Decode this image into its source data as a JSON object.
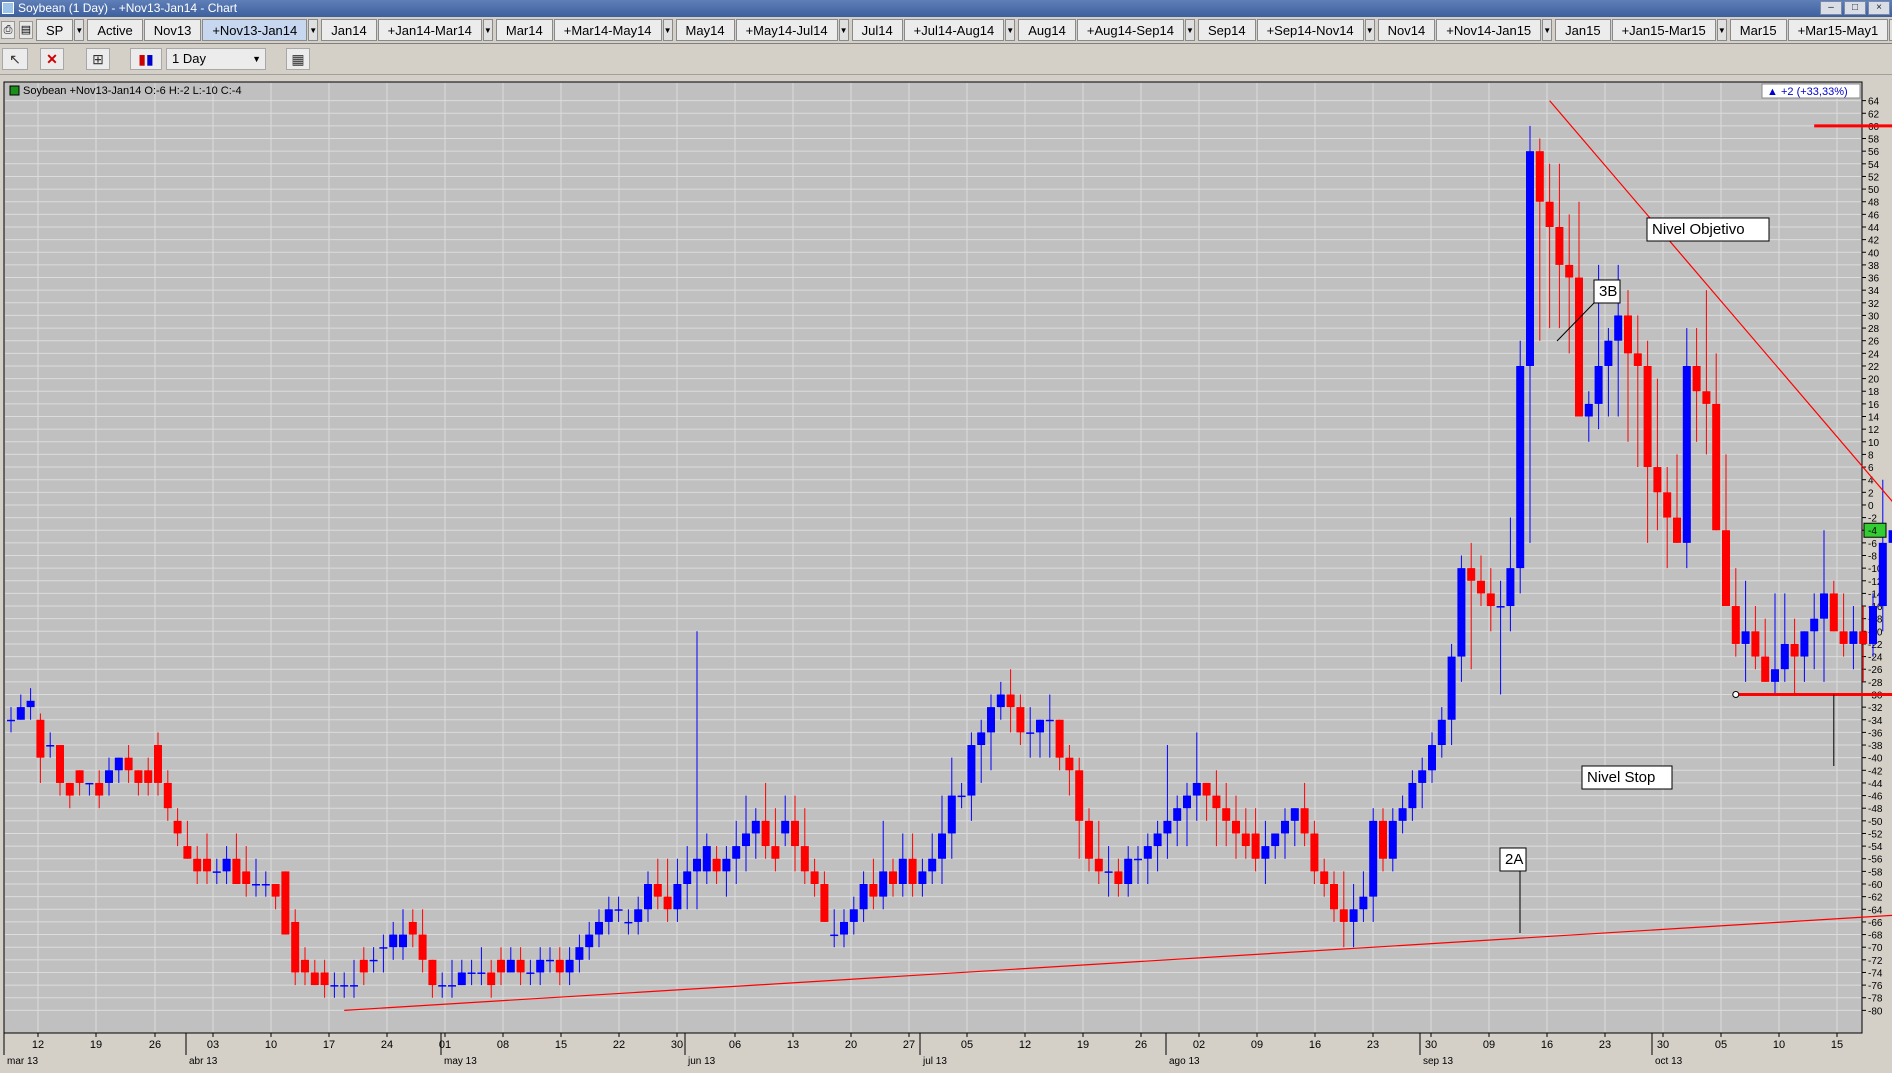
{
  "window": {
    "title": "Soybean (1 Day) - +Nov13-Jan14 - Chart",
    "buttons": [
      "–",
      "□",
      "×"
    ]
  },
  "tabs": [
    "SP",
    "Active",
    "Nov13",
    "+Nov13-Jan14",
    "Jan14",
    "+Jan14-Mar14",
    "Mar14",
    "+Mar14-May14",
    "May14",
    "+May14-Jul14",
    "Jul14",
    "+Jul14-Aug14",
    "Aug14",
    "+Aug14-Sep14",
    "Sep14",
    "+Sep14-Nov14",
    "Nov14",
    "+Nov14-Jan15",
    "Jan15",
    "+Jan15-Mar15",
    "Mar15",
    "+Mar15-May1"
  ],
  "selected_tab": "+Nov13-Jan14",
  "tabs_with_dropdown": [
    "SP",
    "+Nov13-Jan14",
    "+Jan14-Mar14",
    "+Mar14-May14",
    "+May14-Jul14",
    "+Jul14-Aug14",
    "+Aug14-Sep14",
    "+Sep14-Nov14",
    "+Nov14-Jan15",
    "+Jan15-Mar15",
    "+Mar15-May1"
  ],
  "toolbar": {
    "interval": "1 Day"
  },
  "chart": {
    "info": "Soybean +Nov13-Jan14 O:-6 H:-2 L:-10 C:-4",
    "change": "+2 (+33,33%)",
    "last_price": "-4",
    "annotations": {
      "objetivo": "Nivel Objetivo",
      "stop": "Nivel Stop",
      "label_3b": "3B",
      "label_2a": "2A"
    },
    "colors": {
      "up": "#0000ff",
      "down": "#ff0000",
      "background": "#c0c0c0",
      "grid": "#dcdcdc",
      "trend": "#ff0000"
    }
  },
  "chart_data": {
    "type": "candlestick",
    "ylim": [
      -82,
      66
    ],
    "y_ticks": [
      64,
      62,
      60,
      58,
      56,
      54,
      52,
      50,
      48,
      46,
      44,
      42,
      40,
      38,
      36,
      34,
      32,
      30,
      28,
      26,
      24,
      22,
      20,
      18,
      16,
      14,
      12,
      10,
      8,
      6,
      4,
      2,
      0,
      -2,
      -4,
      -6,
      -8,
      -10,
      -12,
      -14,
      -16,
      -18,
      -20,
      -22,
      -24,
      -26,
      -28,
      -30,
      -32,
      -34,
      -36,
      -38,
      -40,
      -42,
      -44,
      -46,
      -48,
      -50,
      -52,
      -54,
      -56,
      -58,
      -60,
      -62,
      -64,
      -66,
      -68,
      -70,
      -72,
      -74,
      -76,
      -78,
      -80
    ],
    "x_day_ticks": [
      "12",
      "19",
      "26",
      "03",
      "10",
      "17",
      "24",
      "01",
      "08",
      "15",
      "22",
      "30",
      "06",
      "13",
      "20",
      "27",
      "05",
      "12",
      "19",
      "26",
      "02",
      "09",
      "16",
      "23",
      "30",
      "09",
      "16",
      "23",
      "30",
      "05",
      "10",
      "15"
    ],
    "x_month_ticks": [
      "mar 13",
      "abr 13",
      "may 13",
      "jun 13",
      "jul 13",
      "ago 13",
      "sep 13",
      "oct 13"
    ],
    "candles": [
      [
        -34,
        -32,
        -36,
        -34
      ],
      [
        -34,
        -30,
        -34,
        -32
      ],
      [
        -32,
        -29,
        -34,
        -31
      ],
      [
        -34,
        -33,
        -44,
        -40
      ],
      [
        -38,
        -36,
        -40,
        -38
      ],
      [
        -38,
        -38,
        -46,
        -44
      ],
      [
        -44,
        -44,
        -48,
        -46
      ],
      [
        -42,
        -42,
        -46,
        -44
      ],
      [
        -44,
        -44,
        -46,
        -44
      ],
      [
        -44,
        -42,
        -48,
        -46
      ],
      [
        -44,
        -40,
        -46,
        -42
      ],
      [
        -42,
        -40,
        -44,
        -40
      ],
      [
        -40,
        -38,
        -44,
        -42
      ],
      [
        -42,
        -42,
        -46,
        -44
      ],
      [
        -42,
        -40,
        -46,
        -44
      ],
      [
        -38,
        -36,
        -46,
        -44
      ],
      [
        -44,
        -42,
        -50,
        -48
      ],
      [
        -50,
        -48,
        -54,
        -52
      ],
      [
        -54,
        -50,
        -56,
        -56
      ],
      [
        -56,
        -54,
        -60,
        -58
      ],
      [
        -56,
        -52,
        -60,
        -58
      ],
      [
        -58,
        -56,
        -60,
        -58
      ],
      [
        -58,
        -54,
        -60,
        -56
      ],
      [
        -56,
        -52,
        -60,
        -60
      ],
      [
        -58,
        -54,
        -62,
        -60
      ],
      [
        -60,
        -56,
        -62,
        -60
      ],
      [
        -60,
        -58,
        -62,
        -60
      ],
      [
        -60,
        -60,
        -64,
        -62
      ],
      [
        -58,
        -58,
        -68,
        -68
      ],
      [
        -66,
        -64,
        -76,
        -74
      ],
      [
        -72,
        -70,
        -76,
        -74
      ],
      [
        -74,
        -72,
        -76,
        -76
      ],
      [
        -74,
        -72,
        -78,
        -76
      ],
      [
        -76,
        -74,
        -78,
        -76
      ],
      [
        -76,
        -74,
        -78,
        -76
      ],
      [
        -76,
        -72,
        -78,
        -76
      ],
      [
        -72,
        -70,
        -76,
        -74
      ],
      [
        -72,
        -70,
        -74,
        -72
      ],
      [
        -70,
        -68,
        -74,
        -70
      ],
      [
        -70,
        -66,
        -72,
        -68
      ],
      [
        -70,
        -64,
        -72,
        -68
      ],
      [
        -66,
        -64,
        -70,
        -68
      ],
      [
        -68,
        -64,
        -74,
        -72
      ],
      [
        -72,
        -72,
        -78,
        -76
      ],
      [
        -76,
        -74,
        -78,
        -76
      ],
      [
        -76,
        -72,
        -78,
        -76
      ],
      [
        -76,
        -72,
        -76,
        -74
      ],
      [
        -74,
        -72,
        -76,
        -74
      ],
      [
        -74,
        -70,
        -76,
        -74
      ],
      [
        -74,
        -72,
        -78,
        -76
      ],
      [
        -72,
        -70,
        -76,
        -74
      ],
      [
        -74,
        -70,
        -74,
        -72
      ],
      [
        -72,
        -70,
        -76,
        -74
      ],
      [
        -74,
        -72,
        -76,
        -74
      ],
      [
        -74,
        -70,
        -76,
        -72
      ],
      [
        -72,
        -70,
        -74,
        -72
      ],
      [
        -72,
        -70,
        -76,
        -74
      ],
      [
        -74,
        -70,
        -76,
        -72
      ],
      [
        -72,
        -68,
        -74,
        -70
      ],
      [
        -70,
        -66,
        -72,
        -68
      ],
      [
        -68,
        -64,
        -70,
        -66
      ],
      [
        -66,
        -62,
        -68,
        -64
      ],
      [
        -64,
        -62,
        -66,
        -64
      ],
      [
        -66,
        -64,
        -68,
        -66
      ],
      [
        -66,
        -62,
        -68,
        -64
      ],
      [
        -64,
        -58,
        -66,
        -60
      ],
      [
        -60,
        -56,
        -64,
        -62
      ],
      [
        -62,
        -56,
        -66,
        -64
      ],
      [
        -64,
        -56,
        -66,
        -60
      ],
      [
        -60,
        -54,
        -64,
        -58
      ],
      [
        -58,
        -20,
        -64,
        -56
      ],
      [
        -58,
        -52,
        -60,
        -54
      ],
      [
        -56,
        -54,
        -60,
        -58
      ],
      [
        -58,
        -54,
        -62,
        -56
      ],
      [
        -56,
        -50,
        -60,
        -54
      ],
      [
        -54,
        -46,
        -58,
        -52
      ],
      [
        -52,
        -48,
        -56,
        -50
      ],
      [
        -50,
        -44,
        -56,
        -54
      ],
      [
        -54,
        -48,
        -58,
        -56
      ],
      [
        -52,
        -46,
        -54,
        -50
      ],
      [
        -50,
        -46,
        -58,
        -54
      ],
      [
        -54,
        -48,
        -60,
        -58
      ],
      [
        -58,
        -56,
        -62,
        -60
      ],
      [
        -60,
        -58,
        -66,
        -66
      ],
      [
        -68,
        -64,
        -70,
        -68
      ],
      [
        -68,
        -64,
        -70,
        -66
      ],
      [
        -66,
        -62,
        -68,
        -64
      ],
      [
        -64,
        -58,
        -66,
        -60
      ],
      [
        -60,
        -56,
        -64,
        -62
      ],
      [
        -62,
        -50,
        -64,
        -58
      ],
      [
        -58,
        -56,
        -62,
        -60
      ],
      [
        -60,
        -52,
        -62,
        -56
      ],
      [
        -56,
        -52,
        -62,
        -60
      ],
      [
        -60,
        -56,
        -62,
        -58
      ],
      [
        -58,
        -52,
        -60,
        -56
      ],
      [
        -56,
        -46,
        -60,
        -52
      ],
      [
        -52,
        -40,
        -56,
        -46
      ],
      [
        -46,
        -44,
        -48,
        -46
      ],
      [
        -46,
        -36,
        -50,
        -38
      ],
      [
        -38,
        -34,
        -44,
        -36
      ],
      [
        -36,
        -30,
        -42,
        -32
      ],
      [
        -32,
        -28,
        -34,
        -30
      ],
      [
        -30,
        -26,
        -36,
        -32
      ],
      [
        -32,
        -30,
        -38,
        -36
      ],
      [
        -36,
        -32,
        -40,
        -36
      ],
      [
        -36,
        -34,
        -40,
        -34
      ],
      [
        -34,
        -30,
        -40,
        -34
      ],
      [
        -34,
        -34,
        -42,
        -40
      ],
      [
        -40,
        -38,
        -46,
        -42
      ],
      [
        -42,
        -40,
        -56,
        -50
      ],
      [
        -50,
        -48,
        -58,
        -56
      ],
      [
        -56,
        -50,
        -60,
        -58
      ],
      [
        -58,
        -54,
        -62,
        -58
      ],
      [
        -58,
        -56,
        -62,
        -60
      ],
      [
        -60,
        -54,
        -62,
        -56
      ],
      [
        -56,
        -54,
        -60,
        -56
      ],
      [
        -56,
        -52,
        -60,
        -54
      ],
      [
        -54,
        -50,
        -58,
        -52
      ],
      [
        -52,
        -38,
        -56,
        -50
      ],
      [
        -50,
        -46,
        -54,
        -48
      ],
      [
        -48,
        -44,
        -54,
        -46
      ],
      [
        -46,
        -36,
        -50,
        -44
      ],
      [
        -44,
        -44,
        -50,
        -46
      ],
      [
        -46,
        -42,
        -54,
        -48
      ],
      [
        -48,
        -44,
        -54,
        -50
      ],
      [
        -50,
        -46,
        -56,
        -52
      ],
      [
        -52,
        -48,
        -56,
        -54
      ],
      [
        -52,
        -48,
        -58,
        -56
      ],
      [
        -56,
        -50,
        -60,
        -54
      ],
      [
        -54,
        -52,
        -56,
        -52
      ],
      [
        -52,
        -48,
        -56,
        -50
      ],
      [
        -50,
        -48,
        -54,
        -48
      ],
      [
        -48,
        -44,
        -54,
        -52
      ],
      [
        -52,
        -50,
        -60,
        -58
      ],
      [
        -58,
        -56,
        -62,
        -60
      ],
      [
        -60,
        -58,
        -66,
        -64
      ],
      [
        -64,
        -58,
        -70,
        -66
      ],
      [
        -66,
        -60,
        -70,
        -64
      ],
      [
        -64,
        -58,
        -66,
        -62
      ],
      [
        -62,
        -48,
        -66,
        -50
      ],
      [
        -50,
        -48,
        -58,
        -56
      ],
      [
        -56,
        -48,
        -58,
        -50
      ],
      [
        -50,
        -46,
        -52,
        -48
      ],
      [
        -48,
        -42,
        -50,
        -44
      ],
      [
        -44,
        -40,
        -48,
        -42
      ],
      [
        -42,
        -36,
        -44,
        -38
      ],
      [
        -38,
        -32,
        -40,
        -34
      ],
      [
        -34,
        -22,
        -38,
        -24
      ],
      [
        -24,
        -8,
        -28,
        -10
      ],
      [
        -10,
        -6,
        -26,
        -12
      ],
      [
        -12,
        -8,
        -16,
        -14
      ],
      [
        -14,
        -10,
        -20,
        -16
      ],
      [
        -16,
        -12,
        -30,
        -16
      ],
      [
        -16,
        -2,
        -20,
        -10
      ],
      [
        -10,
        26,
        -14,
        22
      ],
      [
        22,
        60,
        -6,
        56
      ],
      [
        56,
        58,
        26,
        48
      ],
      [
        48,
        54,
        28,
        44
      ],
      [
        44,
        54,
        28,
        38
      ],
      [
        38,
        46,
        24,
        36
      ],
      [
        36,
        48,
        14,
        14
      ],
      [
        14,
        18,
        10,
        16
      ],
      [
        16,
        38,
        12,
        22
      ],
      [
        22,
        28,
        14,
        26
      ],
      [
        26,
        38,
        14,
        30
      ],
      [
        30,
        34,
        10,
        24
      ],
      [
        24,
        30,
        6,
        22
      ],
      [
        22,
        26,
        -6,
        6
      ],
      [
        6,
        20,
        -4,
        2
      ],
      [
        2,
        6,
        -10,
        -2
      ],
      [
        -2,
        8,
        -6,
        -6
      ],
      [
        -6,
        28,
        -10,
        22
      ],
      [
        22,
        28,
        10,
        18
      ],
      [
        18,
        34,
        8,
        16
      ],
      [
        16,
        24,
        -4,
        -4
      ],
      [
        -4,
        8,
        -14,
        -16
      ],
      [
        -16,
        -10,
        -24,
        -22
      ],
      [
        -22,
        -12,
        -28,
        -20
      ],
      [
        -20,
        -16,
        -26,
        -24
      ],
      [
        -24,
        -18,
        -28,
        -28
      ],
      [
        -28,
        -14,
        -30,
        -26
      ],
      [
        -26,
        -14,
        -28,
        -22
      ],
      [
        -22,
        -18,
        -30,
        -24
      ],
      [
        -24,
        -20,
        -28,
        -20
      ],
      [
        -20,
        -14,
        -26,
        -18
      ],
      [
        -18,
        -4,
        -28,
        -14
      ],
      [
        -14,
        -12,
        -20,
        -20
      ],
      [
        -20,
        -14,
        -24,
        -22
      ],
      [
        -22,
        -16,
        -26,
        -20
      ],
      [
        -20,
        -16,
        -28,
        -22
      ],
      [
        -22,
        -14,
        -24,
        -16
      ],
      [
        -16,
        4,
        -20,
        -6
      ],
      [
        -6,
        -2,
        -10,
        -4
      ]
    ],
    "lines": [
      {
        "name": "downtrend",
        "from": [
          157,
          64
        ],
        "to": [
          200,
          -14
        ]
      },
      {
        "name": "uptrend",
        "from": [
          34,
          -80
        ],
        "to": [
          202,
          -64
        ]
      },
      {
        "name": "nivel_objetivo",
        "from": [
          184,
          60
        ],
        "to": [
          213,
          60
        ]
      },
      {
        "name": "nivel_stop",
        "from": [
          176,
          -30
        ],
        "to": [
          196,
          -30
        ]
      }
    ]
  }
}
